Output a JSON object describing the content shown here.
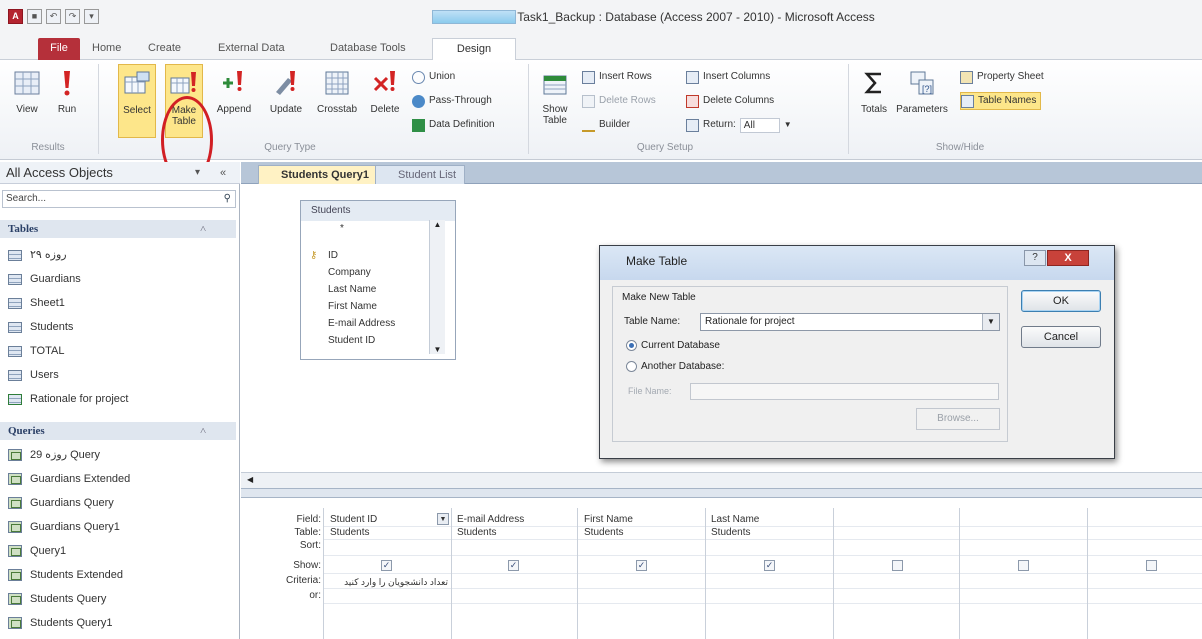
{
  "window": {
    "title": "Task1_Backup : Database (Access 2007 - 2010)  -  Microsoft Access"
  },
  "ribbon": {
    "tabs": {
      "file": "File",
      "home": "Home",
      "create": "Create",
      "external": "External Data",
      "dbtools": "Database Tools",
      "design": "Design"
    },
    "results": {
      "label": "Results",
      "view": "View",
      "run": "Run"
    },
    "query_type": {
      "label": "Query Type",
      "select": "Select",
      "make_table_1": "Make",
      "make_table_2": "Table",
      "append": "Append",
      "update": "Update",
      "crosstab": "Crosstab",
      "delete": "Delete",
      "union": "Union",
      "pass_through": "Pass-Through",
      "data_definition": "Data Definition"
    },
    "query_setup": {
      "label": "Query Setup",
      "show_table_1": "Show",
      "show_table_2": "Table",
      "insert_rows": "Insert Rows",
      "delete_rows": "Delete Rows",
      "builder": "Builder",
      "insert_columns": "Insert Columns",
      "delete_columns": "Delete Columns",
      "return": "Return:",
      "return_value": "All"
    },
    "show_hide": {
      "label": "Show/Hide",
      "totals": "Totals",
      "parameters": "Parameters",
      "property_sheet": "Property Sheet",
      "table_names": "Table Names"
    }
  },
  "nav": {
    "header": "All Access Objects",
    "search_placeholder": "Search...",
    "tables_label": "Tables",
    "tables": [
      "روزه ۲۹",
      "Guardians",
      "Sheet1",
      "Students",
      "TOTAL",
      "Users",
      "Rationale for project"
    ],
    "queries_label": "Queries",
    "queries": [
      "روزه 29 Query",
      "Guardians Extended",
      "Guardians Query",
      "Guardians Query1",
      "Query1",
      "Students Extended",
      "Students Query",
      "Students Query1"
    ]
  },
  "doc_tabs": {
    "active": "Students Query1",
    "other": "Student List"
  },
  "table_box": {
    "title": "Students",
    "fields": [
      "*",
      "ID",
      "Company",
      "Last Name",
      "First Name",
      "E-mail Address",
      "Student ID"
    ]
  },
  "grid": {
    "row_labels": {
      "field": "Field:",
      "table": "Table:",
      "sort": "Sort:",
      "show": "Show:",
      "criteria": "Criteria:",
      "or": "or:"
    },
    "columns": [
      {
        "field": "Student ID",
        "table": "Students",
        "show": true,
        "criteria": "تعداد دانشجویان را وارد کنید"
      },
      {
        "field": "E-mail Address",
        "table": "Students",
        "show": true,
        "criteria": ""
      },
      {
        "field": "First Name",
        "table": "Students",
        "show": true,
        "criteria": ""
      },
      {
        "field": "Last Name",
        "table": "Students",
        "show": true,
        "criteria": ""
      },
      {
        "field": "",
        "table": "",
        "show": false,
        "criteria": ""
      },
      {
        "field": "",
        "table": "",
        "show": false,
        "criteria": ""
      },
      {
        "field": "",
        "table": "",
        "show": false,
        "criteria": ""
      }
    ]
  },
  "dialog": {
    "title": "Make Table",
    "help": "?",
    "close": "X",
    "group_label": "Make New Table",
    "table_name_label": "Table Name:",
    "table_name_value": "Rationale for project",
    "current_db": "Current Database",
    "another_db": "Another Database:",
    "file_name_label": "File Name:",
    "browse": "Browse...",
    "ok": "OK",
    "cancel": "Cancel"
  }
}
